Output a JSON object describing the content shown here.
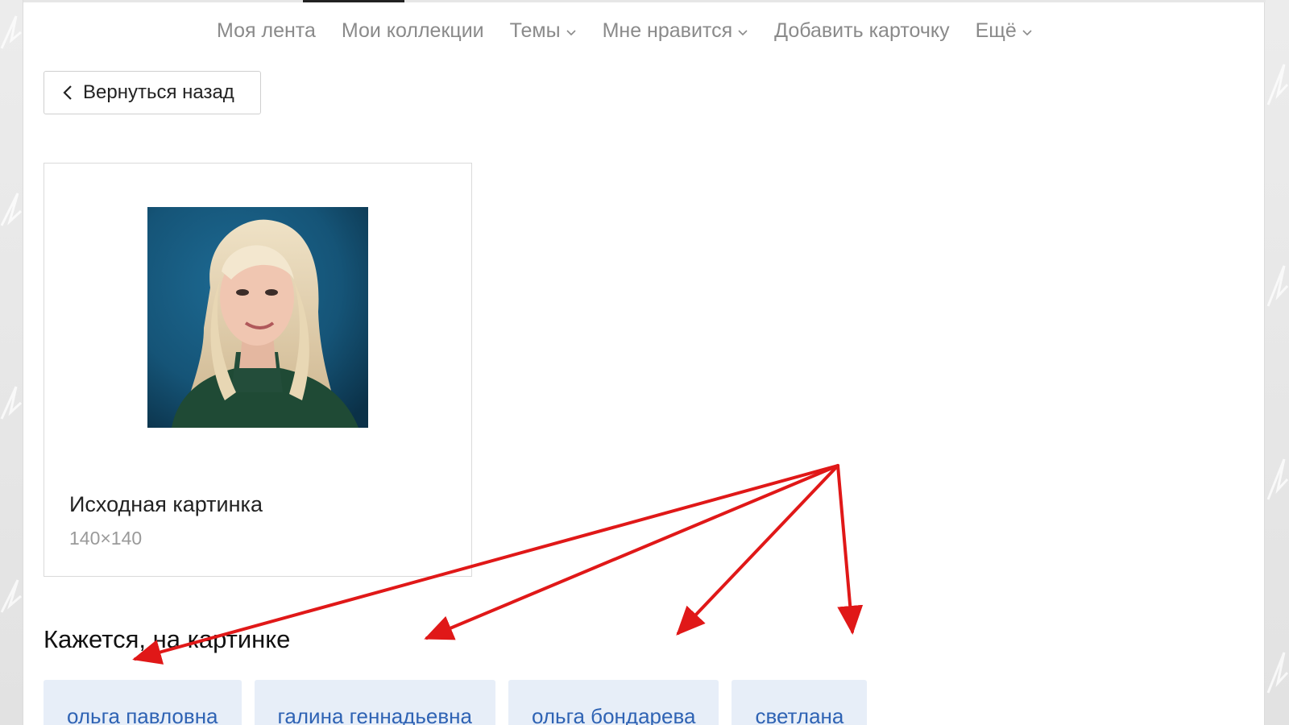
{
  "nav": {
    "items": [
      {
        "label": "Моя лента",
        "dropdown": false
      },
      {
        "label": "Мои коллекции",
        "dropdown": false
      },
      {
        "label": "Темы",
        "dropdown": true
      },
      {
        "label": "Мне нравится",
        "dropdown": true
      },
      {
        "label": "Добавить карточку",
        "dropdown": false
      },
      {
        "label": "Ещё",
        "dropdown": true
      }
    ]
  },
  "back_button": {
    "label": "Вернуться назад",
    "icon": "chevron-left-icon"
  },
  "source_image": {
    "title": "Исходная картинка",
    "size": "140×140",
    "photo": "portrait-photo"
  },
  "tags_section": {
    "heading": "Кажется, на картинке",
    "tags": [
      "ольга павловна",
      "галина геннадьевна",
      "ольга бондарева",
      "светлана"
    ]
  },
  "colors": {
    "nav_text": "#8a8a8a",
    "tag_bg": "#e7eef8",
    "tag_text": "#2f63b4",
    "annotation_arrow": "#e01818"
  }
}
